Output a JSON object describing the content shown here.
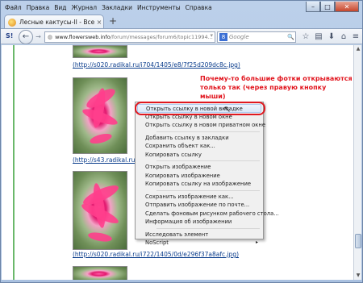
{
  "menubar": {
    "items": [
      "Файл",
      "Правка",
      "Вид",
      "Журнал",
      "Закладки",
      "Инструменты",
      "Справка"
    ]
  },
  "window_controls": {
    "minimize": "–",
    "maximize": "□",
    "close": "✕"
  },
  "tab": {
    "title": "Лесные кактусы-II - Все о ко...",
    "close": "×"
  },
  "newtab": "+",
  "navbar": {
    "url_host": "www.flowersweb.info",
    "url_path": "/forum/messages/forum6/topic11994...",
    "search_placeholder": "Google",
    "s_icon": "S!"
  },
  "content": {
    "links": [
      "(http://s020.radikal.ru/i704/1405/e8/7f25d209dc8c.jpg)",
      "(http://s43.radikal.ru/",
      "(http://s020.radikal.ru/i722/1405/0d/e296f37a8afc.jpg)"
    ],
    "note": "Почему-то большие фотки открываются только так (через правую кнопку мыши)"
  },
  "context_menu": {
    "items": [
      "Открыть ссылку в новой вкладке",
      "Открыть ссылку в новом окне",
      "Открыть ссылку в новом приватном окне",
      "Добавить ссылку в закладки",
      "Сохранить объект как...",
      "Копировать ссылку",
      "Открыть изображение",
      "Копировать изображение",
      "Копировать ссылку на изображение",
      "Сохранить изображение как...",
      "Отправить изображение по почте...",
      "Сделать фоновым рисунком рабочего стола...",
      "Информация об изображении",
      "Исследовать элемент",
      "NoScript"
    ]
  },
  "colors": {
    "accent": "#e01820",
    "link": "#0b3d8c"
  }
}
